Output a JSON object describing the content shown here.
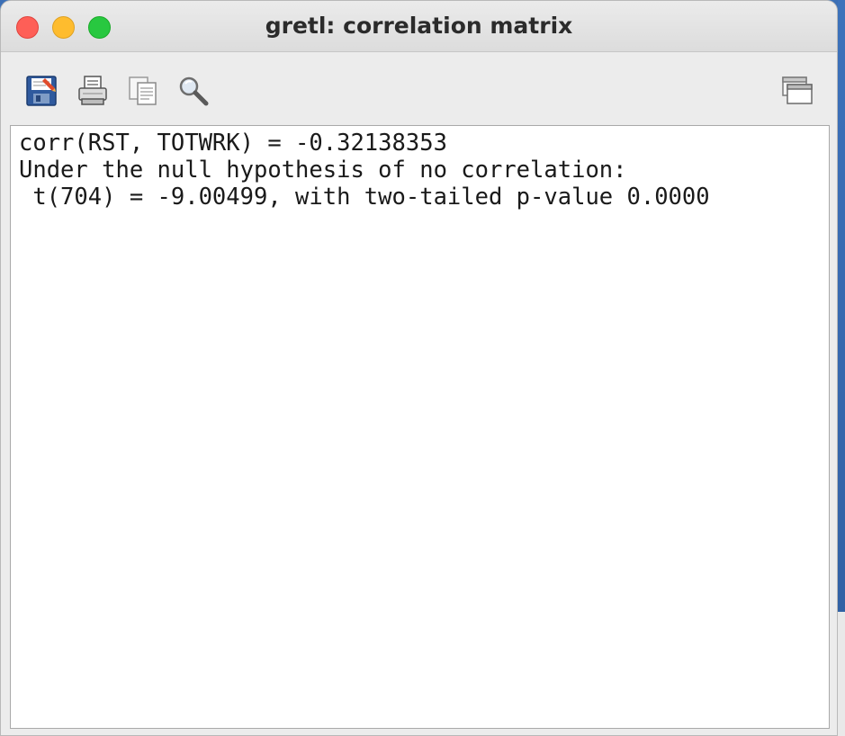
{
  "window": {
    "title": "gretl: correlation matrix"
  },
  "toolbar": {
    "buttons": [
      {
        "icon": "save-icon",
        "tooltip": "Save as..."
      },
      {
        "icon": "print-icon",
        "tooltip": "Print..."
      },
      {
        "icon": "copy-icon",
        "tooltip": "Copy"
      },
      {
        "icon": "find-icon",
        "tooltip": "Find..."
      }
    ],
    "right_button": {
      "icon": "windows-icon"
    }
  },
  "output": {
    "lines": [
      "corr(RST, TOTWRK) = -0.32138353",
      "Under the null hypothesis of no correlation:",
      " t(704) = -9.00499, with two-tailed p-value 0.0000"
    ]
  },
  "colors": {
    "close": "#fe5f57",
    "minimize": "#febc2e",
    "zoom": "#28c840",
    "desktop": "#3b6fb6"
  }
}
